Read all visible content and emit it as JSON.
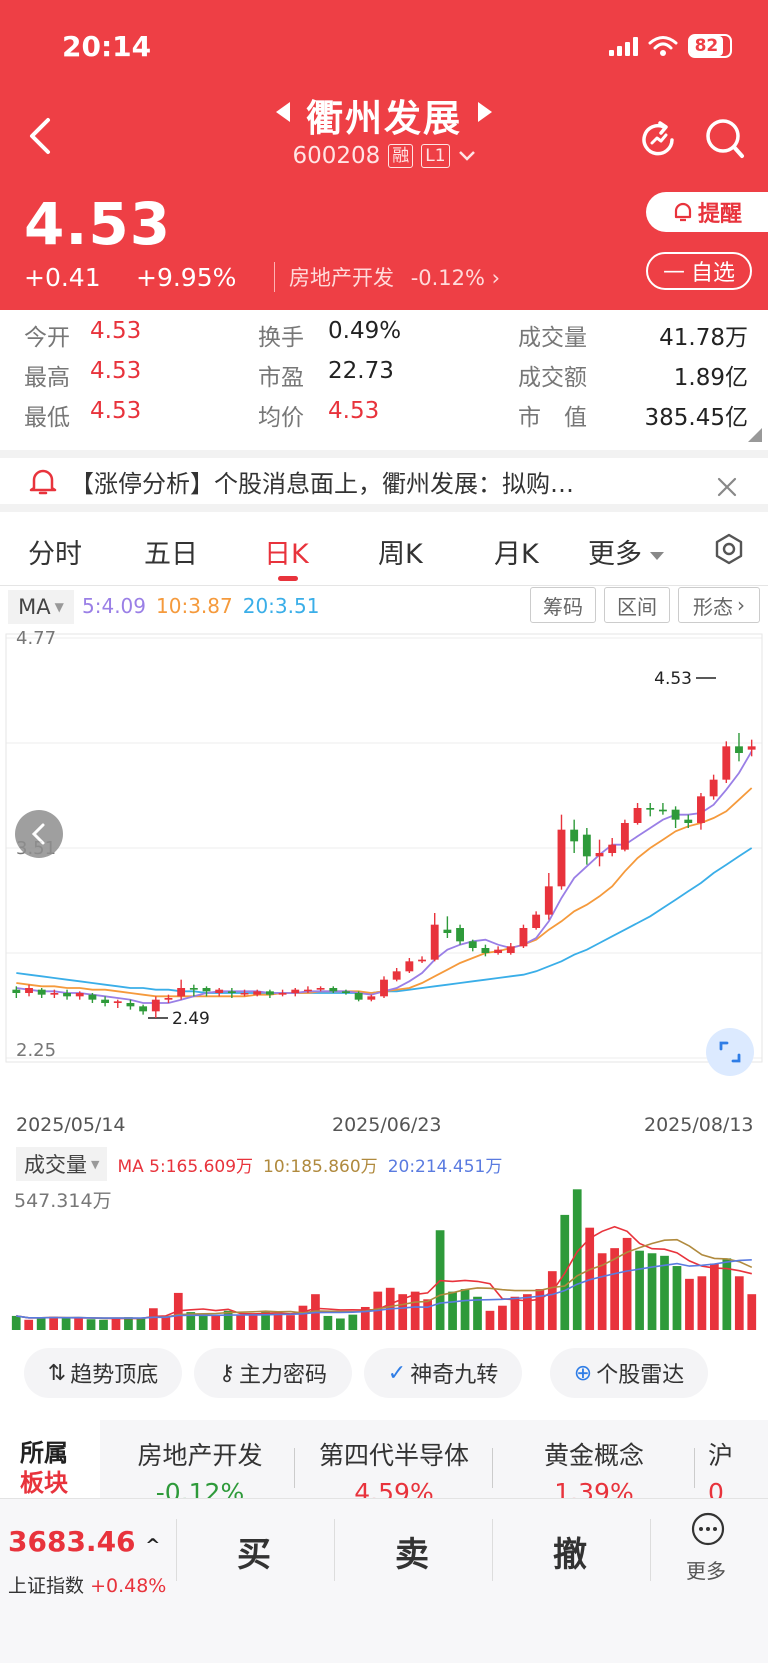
{
  "status": {
    "time": "20:14",
    "battery": "82"
  },
  "header": {
    "stock_name": "衢州发展",
    "stock_code": "600208",
    "tag_margin": "融",
    "tag_level": "L1",
    "price": "4.53",
    "change_abs": "+0.41",
    "change_pct": "+9.95%",
    "sector_name": "房地产开发",
    "sector_change": "-0.12%",
    "remind_label": "提醒",
    "watch_label": "自选"
  },
  "quote": {
    "open_label": "今开",
    "open": "4.53",
    "high_label": "最高",
    "high": "4.53",
    "low_label": "最低",
    "low": "4.53",
    "turnover_label": "换手",
    "turnover": "0.49%",
    "pe_label": "市盈",
    "pe": "22.73",
    "avg_label": "均价",
    "avg": "4.53",
    "volume_label": "成交量",
    "volume": "41.78万",
    "amount_label": "成交额",
    "amount": "1.89亿",
    "mktcap_label": "市　值",
    "mktcap": "385.45亿"
  },
  "notice": {
    "text": "【涨停分析】个股消息面上，衢州发展：拟购…"
  },
  "tabs": [
    "分时",
    "五日",
    "日K",
    "周K",
    "月K",
    "更多"
  ],
  "active_tab": "日K",
  "ma": {
    "button": "MA",
    "ma5": "5:4.09",
    "ma10": "10:3.87",
    "ma20": "20:3.51",
    "ma5_color": "#9a7fe6",
    "ma10_color": "#f59a3c",
    "ma20_color": "#3aaee8"
  },
  "chart_buttons": [
    "筹码",
    "区间",
    "形态"
  ],
  "chart_data": {
    "type": "candlestick",
    "y_axis_labels": [
      "4.77",
      "3.51",
      "2.25"
    ],
    "ylim": [
      2.25,
      4.77
    ],
    "dates": [
      "2025/05/14",
      "2025/06/23",
      "2025/08/13"
    ],
    "markers": {
      "high": "4.53",
      "low": "2.49"
    },
    "up_color": "#e8333c",
    "down_color": "#2e9a3a",
    "candles": [
      {
        "o": 2.66,
        "c": 2.64,
        "h": 2.68,
        "l": 2.61
      },
      {
        "o": 2.64,
        "c": 2.67,
        "h": 2.69,
        "l": 2.62
      },
      {
        "o": 2.66,
        "c": 2.63,
        "h": 2.67,
        "l": 2.61
      },
      {
        "o": 2.63,
        "c": 2.64,
        "h": 2.66,
        "l": 2.61
      },
      {
        "o": 2.64,
        "c": 2.62,
        "h": 2.66,
        "l": 2.6
      },
      {
        "o": 2.62,
        "c": 2.64,
        "h": 2.65,
        "l": 2.6
      },
      {
        "o": 2.63,
        "c": 2.6,
        "h": 2.64,
        "l": 2.58
      },
      {
        "o": 2.6,
        "c": 2.58,
        "h": 2.62,
        "l": 2.56
      },
      {
        "o": 2.58,
        "c": 2.59,
        "h": 2.6,
        "l": 2.55
      },
      {
        "o": 2.58,
        "c": 2.56,
        "h": 2.6,
        "l": 2.54
      },
      {
        "o": 2.56,
        "c": 2.53,
        "h": 2.57,
        "l": 2.51
      },
      {
        "o": 2.53,
        "c": 2.6,
        "h": 2.62,
        "l": 2.49
      },
      {
        "o": 2.6,
        "c": 2.61,
        "h": 2.63,
        "l": 2.58
      },
      {
        "o": 2.62,
        "c": 2.67,
        "h": 2.72,
        "l": 2.6
      },
      {
        "o": 2.67,
        "c": 2.66,
        "h": 2.69,
        "l": 2.62
      },
      {
        "o": 2.67,
        "c": 2.65,
        "h": 2.68,
        "l": 2.62
      },
      {
        "o": 2.64,
        "c": 2.66,
        "h": 2.67,
        "l": 2.62
      },
      {
        "o": 2.65,
        "c": 2.64,
        "h": 2.67,
        "l": 2.61
      },
      {
        "o": 2.64,
        "c": 2.64,
        "h": 2.66,
        "l": 2.62
      },
      {
        "o": 2.63,
        "c": 2.65,
        "h": 2.66,
        "l": 2.62
      },
      {
        "o": 2.65,
        "c": 2.63,
        "h": 2.66,
        "l": 2.61
      },
      {
        "o": 2.63,
        "c": 2.64,
        "h": 2.66,
        "l": 2.62
      },
      {
        "o": 2.64,
        "c": 2.66,
        "h": 2.67,
        "l": 2.62
      },
      {
        "o": 2.66,
        "c": 2.66,
        "h": 2.68,
        "l": 2.64
      },
      {
        "o": 2.66,
        "c": 2.67,
        "h": 2.68,
        "l": 2.65
      },
      {
        "o": 2.67,
        "c": 2.65,
        "h": 2.68,
        "l": 2.64
      },
      {
        "o": 2.65,
        "c": 2.64,
        "h": 2.66,
        "l": 2.63
      },
      {
        "o": 2.64,
        "c": 2.6,
        "h": 2.65,
        "l": 2.59
      },
      {
        "o": 2.6,
        "c": 2.62,
        "h": 2.63,
        "l": 2.59
      },
      {
        "o": 2.62,
        "c": 2.72,
        "h": 2.74,
        "l": 2.61
      },
      {
        "o": 2.72,
        "c": 2.77,
        "h": 2.79,
        "l": 2.71
      },
      {
        "o": 2.77,
        "c": 2.83,
        "h": 2.85,
        "l": 2.76
      },
      {
        "o": 2.83,
        "c": 2.84,
        "h": 2.86,
        "l": 2.82
      },
      {
        "o": 2.84,
        "c": 3.05,
        "h": 3.12,
        "l": 2.83
      },
      {
        "o": 3.02,
        "c": 3.0,
        "h": 3.1,
        "l": 2.97
      },
      {
        "o": 3.03,
        "c": 2.95,
        "h": 3.05,
        "l": 2.93
      },
      {
        "o": 2.95,
        "c": 2.91,
        "h": 2.96,
        "l": 2.89
      },
      {
        "o": 2.91,
        "c": 2.88,
        "h": 2.93,
        "l": 2.86
      },
      {
        "o": 2.88,
        "c": 2.9,
        "h": 2.92,
        "l": 2.87
      },
      {
        "o": 2.88,
        "c": 2.92,
        "h": 2.94,
        "l": 2.87
      },
      {
        "o": 2.92,
        "c": 3.03,
        "h": 3.05,
        "l": 2.91
      },
      {
        "o": 3.03,
        "c": 3.11,
        "h": 3.13,
        "l": 3.02
      },
      {
        "o": 3.11,
        "c": 3.28,
        "h": 3.36,
        "l": 3.08
      },
      {
        "o": 3.28,
        "c": 3.62,
        "h": 3.71,
        "l": 3.26
      },
      {
        "o": 3.62,
        "c": 3.55,
        "h": 3.68,
        "l": 3.48
      },
      {
        "o": 3.59,
        "c": 3.46,
        "h": 3.63,
        "l": 3.41
      },
      {
        "o": 3.46,
        "c": 3.48,
        "h": 3.56,
        "l": 3.4
      },
      {
        "o": 3.48,
        "c": 3.53,
        "h": 3.57,
        "l": 3.46
      },
      {
        "o": 3.5,
        "c": 3.66,
        "h": 3.68,
        "l": 3.49
      },
      {
        "o": 3.66,
        "c": 3.75,
        "h": 3.78,
        "l": 3.65
      },
      {
        "o": 3.75,
        "c": 3.74,
        "h": 3.78,
        "l": 3.7
      },
      {
        "o": 3.74,
        "c": 3.73,
        "h": 3.78,
        "l": 3.71
      },
      {
        "o": 3.74,
        "c": 3.68,
        "h": 3.76,
        "l": 3.63
      },
      {
        "o": 3.68,
        "c": 3.66,
        "h": 3.71,
        "l": 3.63
      },
      {
        "o": 3.66,
        "c": 3.82,
        "h": 3.84,
        "l": 3.62
      },
      {
        "o": 3.82,
        "c": 3.92,
        "h": 3.95,
        "l": 3.8
      },
      {
        "o": 3.92,
        "c": 4.12,
        "h": 4.15,
        "l": 3.9
      },
      {
        "o": 4.12,
        "c": 4.08,
        "h": 4.2,
        "l": 4.03
      },
      {
        "o": 4.1,
        "c": 4.12,
        "h": 4.16,
        "l": 4.06
      }
    ],
    "ma5": [
      2.67,
      2.66,
      2.65,
      2.65,
      2.64,
      2.64,
      2.63,
      2.62,
      2.61,
      2.6,
      2.58,
      2.58,
      2.58,
      2.6,
      2.62,
      2.64,
      2.65,
      2.65,
      2.65,
      2.65,
      2.64,
      2.64,
      2.64,
      2.65,
      2.65,
      2.65,
      2.65,
      2.64,
      2.63,
      2.65,
      2.67,
      2.71,
      2.76,
      2.84,
      2.9,
      2.93,
      2.95,
      2.96,
      2.93,
      2.91,
      2.93,
      2.97,
      3.07,
      3.21,
      3.33,
      3.4,
      3.47,
      3.53,
      3.53,
      3.58,
      3.63,
      3.68,
      3.71,
      3.71,
      3.72,
      3.77,
      3.86,
      3.96,
      4.09
    ],
    "ma10": [
      2.7,
      2.69,
      2.68,
      2.68,
      2.67,
      2.67,
      2.66,
      2.66,
      2.65,
      2.64,
      2.63,
      2.62,
      2.62,
      2.62,
      2.62,
      2.62,
      2.62,
      2.62,
      2.62,
      2.63,
      2.63,
      2.64,
      2.64,
      2.64,
      2.65,
      2.65,
      2.65,
      2.65,
      2.64,
      2.65,
      2.66,
      2.67,
      2.7,
      2.74,
      2.78,
      2.82,
      2.85,
      2.88,
      2.89,
      2.91,
      2.93,
      2.96,
      3.02,
      3.07,
      3.13,
      3.17,
      3.22,
      3.28,
      3.37,
      3.45,
      3.51,
      3.56,
      3.61,
      3.64,
      3.66,
      3.69,
      3.73,
      3.8,
      3.87
    ],
    "ma20": [
      2.76,
      2.75,
      2.74,
      2.73,
      2.72,
      2.71,
      2.7,
      2.69,
      2.68,
      2.67,
      2.67,
      2.66,
      2.66,
      2.65,
      2.65,
      2.64,
      2.64,
      2.64,
      2.64,
      2.64,
      2.64,
      2.64,
      2.64,
      2.64,
      2.64,
      2.64,
      2.64,
      2.64,
      2.64,
      2.65,
      2.65,
      2.66,
      2.67,
      2.68,
      2.69,
      2.7,
      2.71,
      2.72,
      2.73,
      2.74,
      2.75,
      2.77,
      2.8,
      2.83,
      2.87,
      2.9,
      2.94,
      2.98,
      3.02,
      3.06,
      3.1,
      3.15,
      3.2,
      3.25,
      3.3,
      3.36,
      3.41,
      3.46,
      3.51
    ]
  },
  "volume": {
    "button": "成交量",
    "ma5": "MA 5:165.609万",
    "ma10": "10:185.860万",
    "ma20": "20:214.451万",
    "max_label": "547.314万",
    "ymax": 547.314,
    "values": [
      55,
      40,
      48,
      52,
      45,
      50,
      42,
      40,
      45,
      50,
      45,
      85,
      50,
      145,
      70,
      60,
      55,
      75,
      60,
      65,
      70,
      62,
      58,
      95,
      140,
      55,
      45,
      60,
      90,
      150,
      165,
      140,
      150,
      120,
      390,
      150,
      160,
      130,
      75,
      95,
      130,
      140,
      160,
      230,
      450,
      550,
      400,
      300,
      320,
      360,
      310,
      300,
      290,
      250,
      200,
      210,
      260,
      280,
      210,
      140
    ]
  },
  "tools": [
    "趋势顶底",
    "主力密码",
    "神奇九转",
    "个股雷达"
  ],
  "sectors": {
    "title_line1": "所属",
    "title_line2": "板块",
    "items": [
      {
        "name": "房地产开发",
        "change": "-0.12%"
      },
      {
        "name": "第四代半导体",
        "change": "4.59%"
      },
      {
        "name": "黄金概念",
        "change": "1.39%"
      },
      {
        "name": "沪",
        "change": "0"
      }
    ]
  },
  "bottom": {
    "index_value": "3683.46",
    "index_name": "上证指数",
    "index_change": "+0.48%",
    "buy": "买",
    "sell": "卖",
    "cancel": "撤",
    "more": "更多"
  }
}
